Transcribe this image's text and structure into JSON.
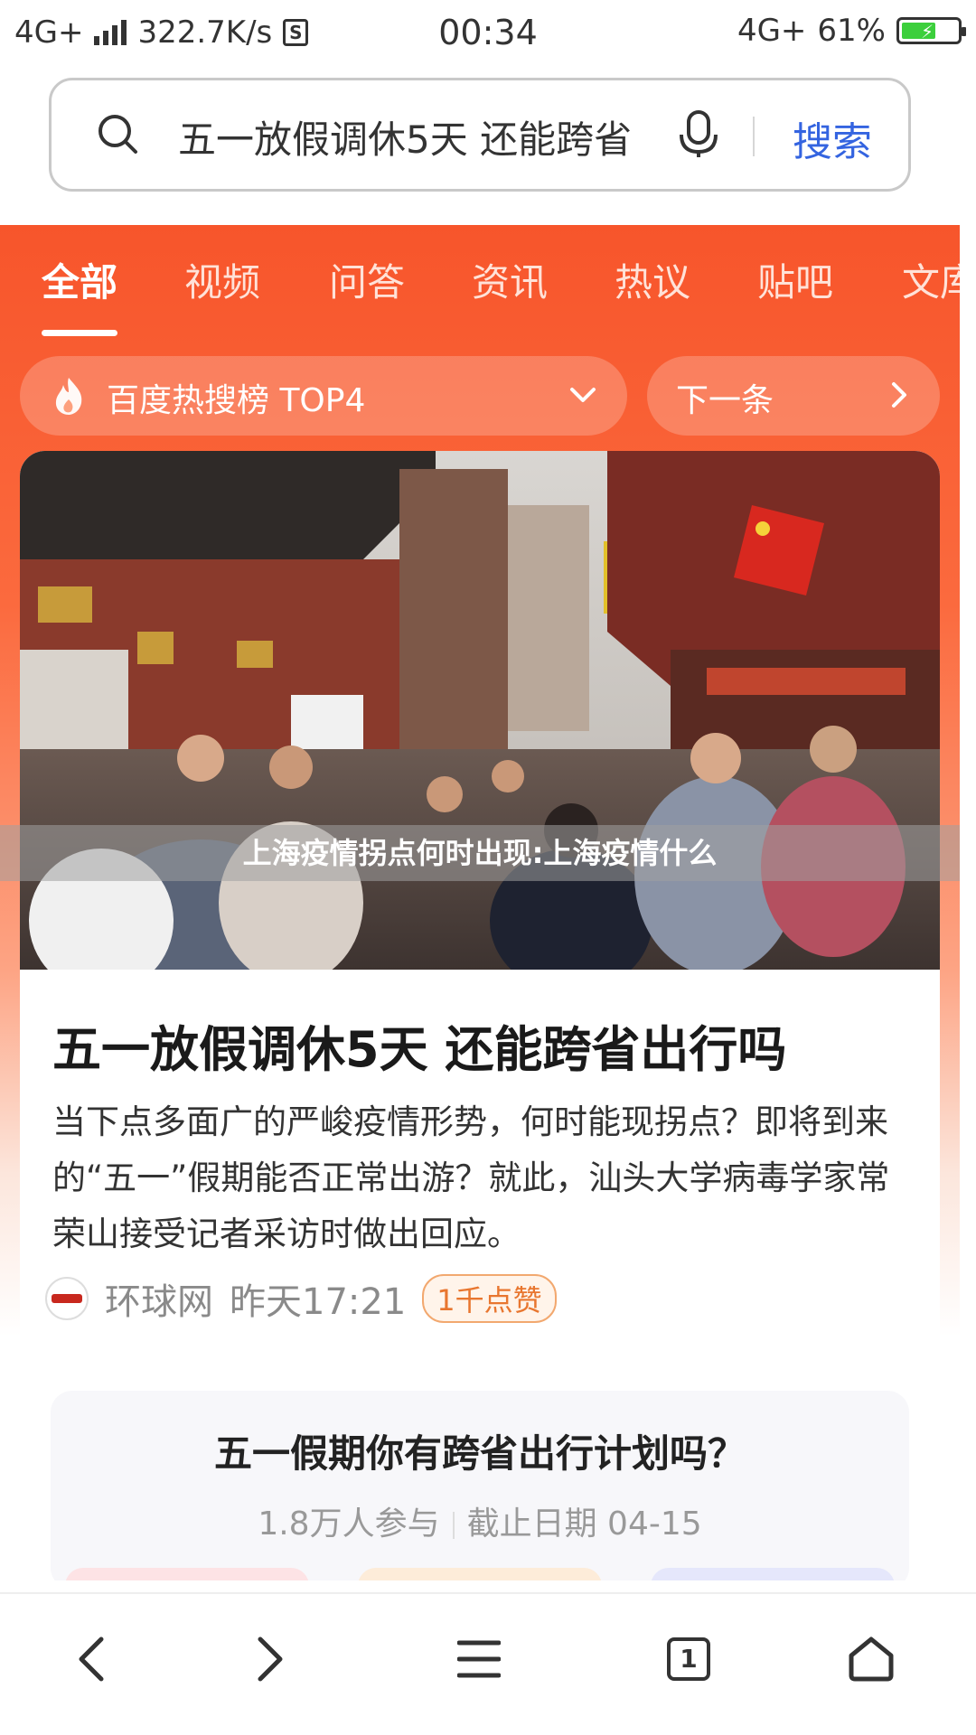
{
  "status_bar": {
    "network": "4G+",
    "speed": "322.7K/s",
    "speed_icon": "S",
    "time": "00:34",
    "network_right": "4G+",
    "battery": "61%",
    "battery_level": 0.61
  },
  "search": {
    "query": "五一放假调休5天 还能跨省",
    "button": "搜索"
  },
  "tabs": [
    "全部",
    "视频",
    "问答",
    "资讯",
    "热议",
    "贴吧",
    "文库"
  ],
  "hot": {
    "label": "百度热搜榜 TOP4",
    "next": "下一条"
  },
  "watermark": "上海疫情拐点何时出现:上海疫情什么",
  "article": {
    "title": "五一放假调休5天 还能跨省出行吗",
    "summary": "当下点多面广的严峻疫情形势，何时能现拐点？即将到来的“五一”假期能否正常出游？就此，汕头大学病毒学家常荣山接受记者采访时做出回应。",
    "source": "环球网",
    "time": "昨天17:21",
    "likes": "1千点赞"
  },
  "poll": {
    "title": "五一假期你有跨省出行计划吗？",
    "participants": "1.8万人参与",
    "deadline": "截止日期 04-15"
  },
  "bottom_nav": {
    "tab_count": "1"
  },
  "colors": {
    "brand_orange": "#f7552b",
    "search_blue": "#3464e0",
    "likes_orange": "#e8762f"
  }
}
